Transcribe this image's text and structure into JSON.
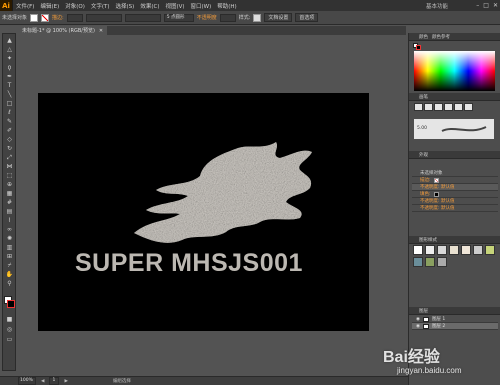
{
  "menubar": {
    "logo": "Ai",
    "items": [
      "文件(F)",
      "编辑(E)",
      "对象(O)",
      "文字(T)",
      "选择(S)",
      "效果(C)",
      "视图(V)",
      "窗口(W)",
      "帮助(H)"
    ],
    "workspace": "基本功能"
  },
  "controlbar": {
    "selection": "未选择对象",
    "stroke_label": "描边:",
    "stroke_size": "5 点圆形",
    "opacity_label": "不透明度",
    "style_label": "样式:",
    "doc_setup": "文档设置",
    "prefs": "首选项"
  },
  "document_tab": "未标题-1* @ 100% (RGB/预览)",
  "artboard": {
    "text": "SUPER MHSJS001",
    "blob_color": "#cfcbc5",
    "text_color": "#bcb8b2"
  },
  "statusbar": {
    "zoom": "100%",
    "page": "1",
    "tool": "编组选择"
  },
  "panels": {
    "color_tab": "颜色",
    "color_guide_tab": "颜色参考",
    "brush_tab": "画笔",
    "brush_size": "5.00",
    "appearance_tab": "外观",
    "appearance_header": "未选择对象",
    "stroke_row": "描边:",
    "fill_row": "填色:",
    "opacity_rows": [
      "不透明度: 默认值",
      "不透明度: 默认值",
      "不透明度: 默认值"
    ],
    "graphic_styles_tab": "图形样式",
    "layers_tab": "图层",
    "layers": [
      "图层 1",
      "图层 2"
    ]
  },
  "watermark": {
    "brand": "Bai经验",
    "url": "jingyan.baidu.com"
  }
}
